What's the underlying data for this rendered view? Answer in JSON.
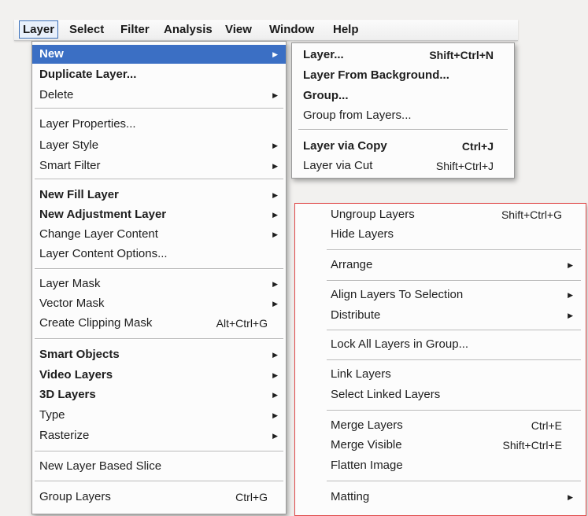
{
  "menubar": {
    "items": [
      "Layer",
      "Select",
      "Filter",
      "Analysis",
      "View",
      "Window",
      "Help"
    ],
    "active": "Layer"
  },
  "layer_menu": {
    "items": [
      {
        "label": "New",
        "arrow": "▶"
      },
      {
        "label": "Duplicate Layer..."
      },
      {
        "label": "Delete",
        "arrow": "▶"
      },
      {
        "label": "Layer Properties..."
      },
      {
        "label": "Layer Style",
        "arrow": "▶"
      },
      {
        "label": "Smart Filter",
        "arrow": "▶"
      },
      {
        "label": "New Fill Layer",
        "arrow": "▶"
      },
      {
        "label": "New Adjustment Layer",
        "arrow": "▶"
      },
      {
        "label": "Change Layer Content",
        "arrow": "▶"
      },
      {
        "label": "Layer Content Options..."
      },
      {
        "label": "Layer Mask",
        "arrow": "▶"
      },
      {
        "label": "Vector Mask",
        "arrow": "▶"
      },
      {
        "label": "Create Clipping Mask",
        "shortcut": "Alt+Ctrl+G"
      },
      {
        "label": "Smart Objects",
        "arrow": "▶"
      },
      {
        "label": "Video Layers",
        "arrow": "▶"
      },
      {
        "label": "3D Layers",
        "arrow": "▶"
      },
      {
        "label": "Type",
        "arrow": "▶"
      },
      {
        "label": "Rasterize",
        "arrow": "▶"
      },
      {
        "label": "New Layer Based Slice"
      },
      {
        "label": "Group Layers",
        "shortcut": "Ctrl+G"
      }
    ]
  },
  "new_submenu": {
    "items": [
      {
        "label": "Layer...",
        "shortcut": "Shift+Ctrl+N"
      },
      {
        "label": "Layer From Background..."
      },
      {
        "label": "Group..."
      },
      {
        "label": "Group from Layers..."
      },
      {
        "label": "Layer via Copy",
        "shortcut": "Ctrl+J"
      },
      {
        "label": "Layer via Cut",
        "shortcut": "Shift+Ctrl+J"
      }
    ]
  },
  "group_menu": {
    "items": [
      {
        "label": "Ungroup Layers",
        "shortcut": "Shift+Ctrl+G"
      },
      {
        "label": "Hide Layers"
      },
      {
        "label": "Arrange",
        "arrow": "▶"
      },
      {
        "label": "Align Layers To Selection",
        "arrow": "▶"
      },
      {
        "label": "Distribute",
        "arrow": "▶"
      },
      {
        "label": "Lock All Layers in Group..."
      },
      {
        "label": "Link Layers"
      },
      {
        "label": "Select Linked Layers"
      },
      {
        "label": "Merge Layers",
        "shortcut": "Ctrl+E"
      },
      {
        "label": "Merge Visible",
        "shortcut": "Shift+Ctrl+E"
      },
      {
        "label": "Flatten Image"
      },
      {
        "label": "Matting",
        "arrow": "▶"
      }
    ]
  },
  "colors": {
    "highlight": "#3b6fc4",
    "callout_border": "#e04848",
    "background": "#f2f1ef"
  }
}
